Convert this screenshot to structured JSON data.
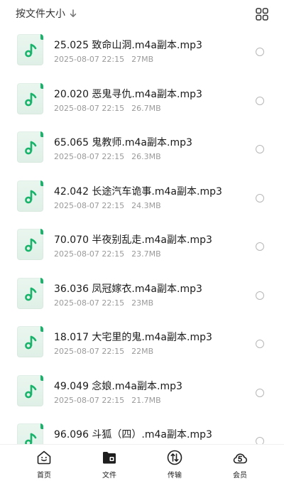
{
  "header": {
    "sort_label": "按文件大小",
    "sort_icon": "arrow-down-icon",
    "view_icon": "grid-view-icon"
  },
  "files": [
    {
      "name": "25.025 致命山洞.m4a副本.mp3",
      "date": "2025-08-07 22:15",
      "size": "27MB"
    },
    {
      "name": "20.020 恶鬼寻仇.m4a副本.mp3",
      "date": "2025-08-07 22:15",
      "size": "26.7MB"
    },
    {
      "name": "65.065 鬼教师.m4a副本.mp3",
      "date": "2025-08-07 22:15",
      "size": "26.3MB"
    },
    {
      "name": "42.042 长途汽车诡事.m4a副本.mp3",
      "date": "2025-08-07 22:15",
      "size": "24.3MB"
    },
    {
      "name": "70.070 半夜别乱走.m4a副本.mp3",
      "date": "2025-08-07 22:15",
      "size": "23.7MB"
    },
    {
      "name": "36.036 凤冠嫁衣.m4a副本.mp3",
      "date": "2025-08-07 22:15",
      "size": "23MB"
    },
    {
      "name": "18.017 大宅里的鬼.m4a副本.mp3",
      "date": "2025-08-07 22:15",
      "size": "22MB"
    },
    {
      "name": "49.049 念娘.m4a副本.mp3",
      "date": "2025-08-07 22:15",
      "size": "21.7MB"
    },
    {
      "name": "96.096 斗狐（四）.m4a副本.mp3",
      "date": "",
      "size": ""
    }
  ],
  "tabbar": {
    "tabs": [
      {
        "label": "首页",
        "icon": "home-smile-icon"
      },
      {
        "label": "文件",
        "icon": "folder-icon",
        "active": true
      },
      {
        "label": "传输",
        "icon": "transfer-icon"
      },
      {
        "label": "会员",
        "icon": "vip-cloud-icon"
      }
    ]
  },
  "colors": {
    "accent_green": "#19b36b",
    "thumb_bg": "#e6f4ec",
    "meta_gray": "#9a9a9a"
  }
}
